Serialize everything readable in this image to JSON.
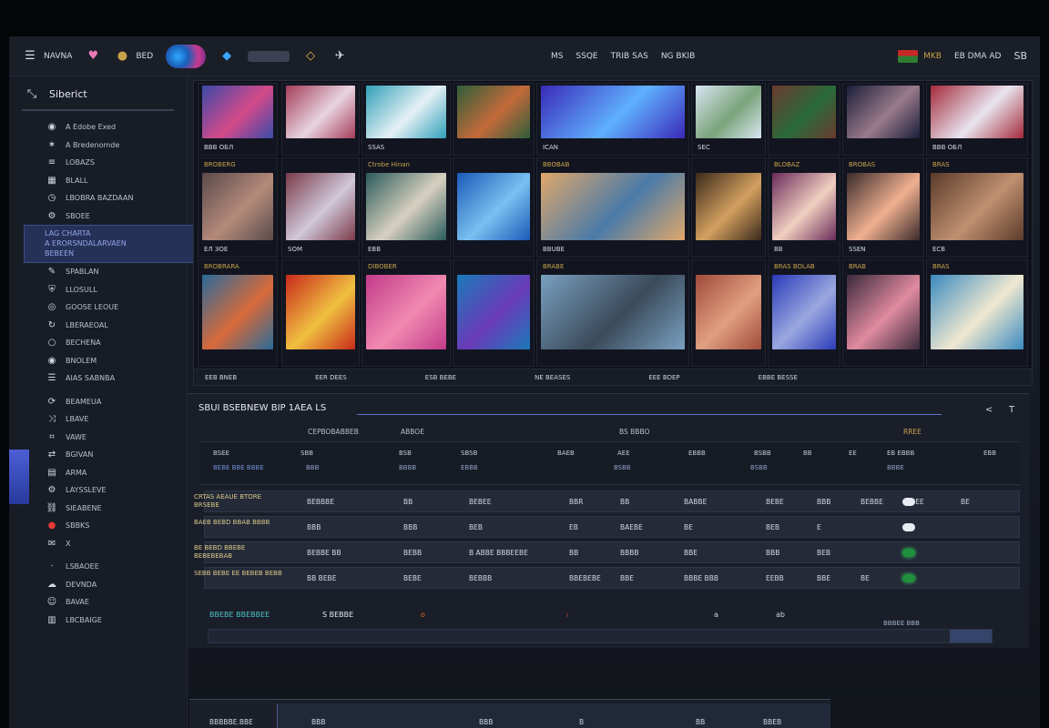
{
  "topbar": {
    "left_items": [
      {
        "icon": "menu-icon",
        "label": "NAVNA"
      },
      {
        "icon": "heart-logo-icon",
        "label": ""
      },
      {
        "icon": "coin-icon",
        "label": "BED"
      }
    ],
    "middle_items": [
      {
        "icon": "pin-icon",
        "label": "◇"
      },
      {
        "icon": "bird-icon",
        "label": ""
      }
    ],
    "right_items": [
      {
        "icon": "",
        "label": "MS"
      },
      {
        "icon": "",
        "label": "SSQE"
      },
      {
        "icon": "",
        "label": "TRIB SAS"
      },
      {
        "icon": "",
        "label": "NG BKIB"
      }
    ],
    "account": {
      "flag_label": "MKB",
      "user": "EB DMA AD",
      "count": "SB"
    }
  },
  "sidebar": {
    "title": "Siberict",
    "items": [
      {
        "icon": "globe-icon",
        "label": "A Edobe Exed"
      },
      {
        "icon": "star-icon",
        "label": "A Bredenomde"
      },
      {
        "icon": "bars-icon",
        "label": "LOBAZS"
      },
      {
        "icon": "grid-icon",
        "label": "BLALL"
      },
      {
        "icon": "clock-icon",
        "label": "LBOBRA BAZDAAN"
      },
      {
        "icon": "gear-icon",
        "label": "SBOEE"
      },
      {
        "icon": "",
        "label": "LAG CHARTA"
      },
      {
        "icon": "",
        "label": "A ERORSNDALARVAEN"
      },
      {
        "icon": "",
        "label": "BEBEEN"
      },
      {
        "icon": "pen-icon",
        "label": "SPABLAN"
      },
      {
        "icon": "shield-icon",
        "label": "LLOSULL"
      },
      {
        "icon": "coin-icon",
        "label": "GOOSE LEOUE"
      },
      {
        "icon": "refresh-icon",
        "label": "LBERAEOAL"
      },
      {
        "icon": "circle-icon",
        "label": "BECHENA"
      },
      {
        "icon": "globe-icon",
        "label": "BNOLEM"
      },
      {
        "icon": "list-icon",
        "label": "AIAS SABNBA"
      },
      {
        "icon": "sync-icon",
        "label": "BEAMEUA"
      },
      {
        "icon": "shuffle-icon",
        "label": "LBAVE"
      },
      {
        "icon": "tag-icon",
        "label": "VAWE"
      },
      {
        "icon": "swap-icon",
        "label": "BGIVAN"
      },
      {
        "icon": "table-icon",
        "label": "ARMA"
      },
      {
        "icon": "settings-icon",
        "label": "LAYSSLEVE"
      },
      {
        "icon": "link-icon",
        "label": "SIEABENE"
      },
      {
        "icon": "record-icon",
        "label": "SBBKS"
      },
      {
        "icon": "chat-icon",
        "label": "X"
      },
      {
        "icon": "",
        "label": "LSBAOEE"
      },
      {
        "icon": "cloud-icon",
        "label": "DEVNDA"
      },
      {
        "icon": "user-icon",
        "label": "BAVAE"
      },
      {
        "icon": "chart-icon",
        "label": "LBCBAIGE"
      }
    ]
  },
  "grid": {
    "rows": [
      [
        {
          "caption": "",
          "meta": "ВВВ ОБЛ",
          "c1": "#3a4aa8",
          "c2": "#d44a8a"
        },
        {
          "caption": "",
          "meta": "",
          "c1": "#a43d5a",
          "c2": "#e8d4e0"
        },
        {
          "caption": "",
          "meta": "SSAS",
          "c1": "#2fa0b8",
          "c2": "#e6f0f5"
        },
        {
          "caption": "",
          "meta": "",
          "c1": "#2e5e3a",
          "c2": "#c46a3a"
        },
        {
          "caption": "",
          "meta": "ICAN",
          "c1": "#3a2ab8",
          "c2": "#5fb0ff"
        },
        {
          "caption": "",
          "meta": "SEC",
          "c1": "#d8e6f2",
          "c2": "#7aa37a"
        },
        {
          "caption": "",
          "meta": "",
          "c1": "#6a3a2e",
          "c2": "#2a6a3a"
        },
        {
          "caption": "",
          "meta": "",
          "c1": "#1a1e3a",
          "c2": "#9a7a8a"
        },
        {
          "caption": "",
          "meta": "ВВВ ОБЛ",
          "c1": "#a42a3a",
          "c2": "#e8e4ef"
        }
      ],
      [
        {
          "caption": "BROBERG",
          "meta": "ЕЛ ЗОЕ",
          "c1": "#5a4a4a",
          "c2": "#b48a7a"
        },
        {
          "caption": "",
          "meta": "SOM",
          "c1": "#7a3a4a",
          "c2": "#d0c8d8"
        },
        {
          "caption": "Ctrobe Hinan",
          "meta": "ЕВВ",
          "c1": "#2a5a5a",
          "c2": "#d8d0c0"
        },
        {
          "caption": "",
          "meta": "",
          "c1": "#1a5ab8",
          "c2": "#7ac0f0"
        },
        {
          "caption": "BBOBAB",
          "meta": "BBUBE",
          "c1": "#e0a86a",
          "c2": "#4a7aa8"
        },
        {
          "caption": "",
          "meta": "",
          "c1": "#3a2a1a",
          "c2": "#d4a060"
        },
        {
          "caption": "BLOBAZ",
          "meta": "ВВ",
          "c1": "#6a2a5a",
          "c2": "#f0d0c0"
        },
        {
          "caption": "BROBAS",
          "meta": "SSEN",
          "c1": "#3a2a2a",
          "c2": "#f0b090"
        },
        {
          "caption": "BRAS",
          "meta": "ЕСВ",
          "c1": "#5a3a2a",
          "c2": "#c09070"
        }
      ],
      [
        {
          "caption": "BROBRARA",
          "meta": "",
          "c1": "#2a6a9a",
          "c2": "#d86a3a"
        },
        {
          "caption": "",
          "meta": "",
          "c1": "#c82a1a",
          "c2": "#f0c040"
        },
        {
          "caption": "DIBOBER",
          "meta": "",
          "c1": "#c23a8a",
          "c2": "#f08ab0"
        },
        {
          "caption": "",
          "meta": "",
          "c1": "#1a7ab8",
          "c2": "#6a3ab8"
        },
        {
          "caption": "BRABE",
          "meta": "",
          "c1": "#7aa0c0",
          "c2": "#3a4a5a"
        },
        {
          "caption": "",
          "meta": "",
          "c1": "#a04a3a",
          "c2": "#e0a080"
        },
        {
          "caption": "BRAS BOLAB",
          "meta": "",
          "c1": "#2a3ab8",
          "c2": "#9aa8e0"
        },
        {
          "caption": "BRAB",
          "meta": "",
          "c1": "#3a2a3a",
          "c2": "#e08aa0"
        },
        {
          "caption": "BRAS",
          "meta": "",
          "c1": "#3a8ac0",
          "c2": "#f0e8d0"
        }
      ]
    ],
    "footer": [
      "EEB BNEB",
      "EER DEES",
      "ESB BEBE",
      "NE BEASES",
      "EEE BDEP",
      "EBBE BESSE"
    ]
  },
  "summary": {
    "title": "SBUI BSEBNEW BIP 1AEA LS",
    "controls": [
      "<",
      "T"
    ],
    "header": [
      "CEPBOBABBEB",
      "ABBOE",
      "BS BBBO",
      "RREE"
    ],
    "subheader_a": [
      "BSEE",
      "SBB",
      "BSB",
      "SBSB",
      "BAEB",
      "AEE",
      "EBBB",
      "BSBB",
      "BB",
      "EE",
      "EB EBBB",
      "EBB"
    ],
    "subheader_b": [
      "BEBE BBE BBBE",
      "BBB",
      "BBBB",
      "EBBB",
      "BSBB",
      "BSBB",
      "BBBE"
    ],
    "rows": [
      {
        "label": "CRTAS AEAUE BTORE BRSEBE",
        "cells": [
          "BEBBBE",
          "BB",
          "BEBEE",
          "BBR",
          "BB",
          "BABBE",
          "BEBE",
          "BBB",
          "BEBBE",
          "ABEE",
          "BE"
        ]
      },
      {
        "label": "BAEB BEBD BBAB BBBB",
        "cells": [
          "BBB",
          "BBB",
          "BEB",
          "EB",
          "BAEBE",
          "BE",
          "BEB",
          "E"
        ]
      },
      {
        "label": "BE BEBD BBEBE BEBEBEBAB",
        "cells": [
          "BEBBE BB",
          "BEBB",
          "B ABBE BBBEEBE",
          "BB",
          "BBBB",
          "BBE",
          "BBB",
          "BEB"
        ]
      },
      {
        "label": "SEBB BEBE EE BEBEB BEBB",
        "cells": [
          "BB BEBE",
          "BEBE",
          "BEBBB",
          "BBEBEBE",
          "BBE",
          "BBBE BBB",
          "EEBB",
          "BBE",
          "BE"
        ]
      }
    ],
    "footer_label": "BBEBE BBEBBEE",
    "footer_label2": "S BEBBE",
    "footer_value": "BBBEE BBB",
    "progress": 0.054
  },
  "bottom_table": {
    "cells": [
      "BBBBBE.BBE",
      "BBB",
      "BBB",
      "B",
      "BB",
      "BBEB"
    ]
  },
  "colors": {
    "accent": "#5a76c6",
    "gold": "#c9a24a",
    "teal": "#4fc3c8",
    "background": "#1b1f29"
  }
}
